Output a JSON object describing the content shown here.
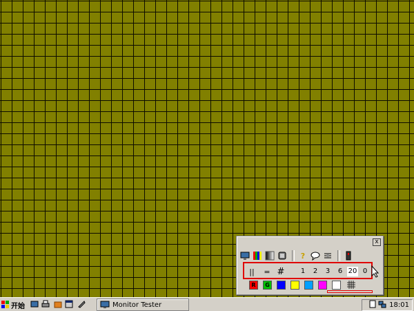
{
  "taskbar": {
    "start_label": "开始",
    "task_title": "Monitor Tester",
    "clock": "18:01"
  },
  "tool": {
    "close_glyph": "x",
    "row1_icons": [
      "monitor-icon",
      "color-bars-icon",
      "gradient-icon",
      "screen-icon",
      "help-icon",
      "speech-bubble-icon",
      "settings-icon",
      "exit-icon"
    ],
    "row2": {
      "line_buttons": [
        "||",
        "=",
        "#"
      ],
      "numbers": [
        "1",
        "2",
        "3",
        "6",
        "20",
        "0"
      ]
    },
    "row3_swatches": [
      {
        "color": "#ff0000",
        "label": "R"
      },
      {
        "color": "#00c000",
        "label": "G"
      },
      {
        "color": "#0000ff",
        "label": ""
      },
      {
        "color": "#ffff00",
        "label": ""
      },
      {
        "color": "#00a0ff",
        "label": ""
      },
      {
        "color": "#ff00ff",
        "label": ""
      },
      {
        "color": "#ffffff",
        "label": ""
      }
    ]
  },
  "colors": {
    "desktop": "#818000",
    "grid_line": "#0c0c00",
    "highlight": "#e00000"
  }
}
